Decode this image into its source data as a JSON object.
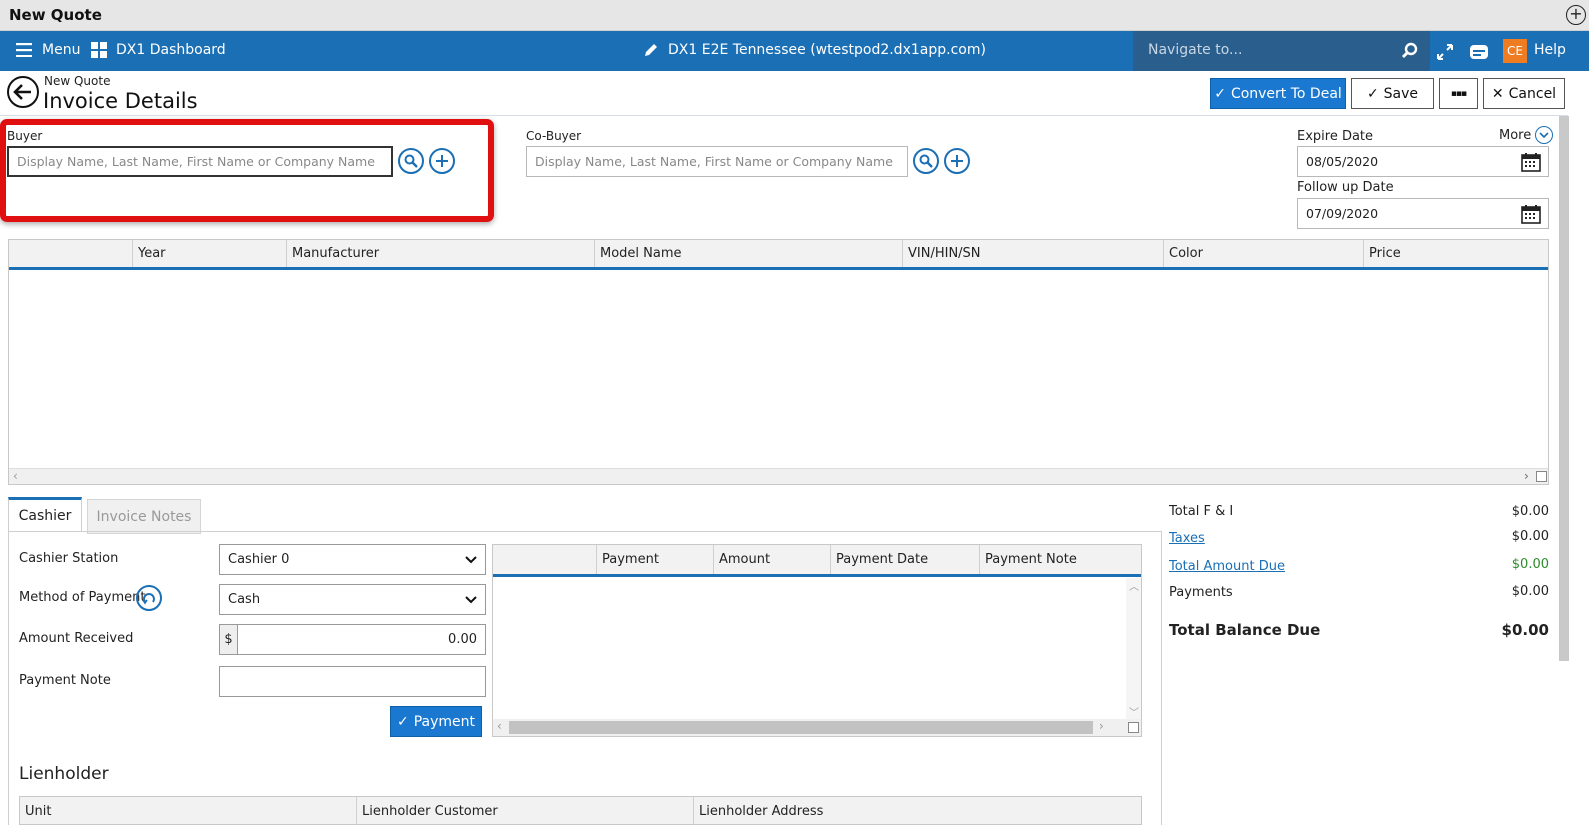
{
  "window": {
    "title": "New Quote"
  },
  "nav": {
    "menu_label": "Menu",
    "dashboard_label": "DX1 Dashboard",
    "site_label": "DX1 E2E Tennessee (wtestpod2.dx1app.com)",
    "search_placeholder": "Navigate to...",
    "avatar_initials": "CE",
    "help_label": "Help"
  },
  "header": {
    "breadcrumb": "New Quote",
    "title": "Invoice Details",
    "convert_label": "Convert To Deal",
    "save_label": "Save",
    "more_dots": "▪▪▪",
    "cancel_label": "Cancel"
  },
  "buyer": {
    "label": "Buyer",
    "placeholder": "Display Name, Last Name, First Name or Company Name"
  },
  "cobuyer": {
    "label": "Co-Buyer",
    "placeholder": "Display Name, Last Name, First Name or Company Name"
  },
  "dates": {
    "more_label": "More",
    "expire_label": "Expire Date",
    "expire_value": "08/05/2020",
    "followup_label": "Follow up Date",
    "followup_value": "07/09/2020"
  },
  "units_grid": {
    "columns": [
      "Year",
      "Manufacturer",
      "Model Name",
      "VIN/HIN/SN",
      "Color",
      "Price"
    ]
  },
  "tabs": [
    {
      "label": "Cashier",
      "active": true
    },
    {
      "label": "Invoice Notes",
      "active": false
    }
  ],
  "cashier": {
    "station_label": "Cashier Station",
    "station_value": "Cashier 0",
    "method_label": "Method of Payment",
    "method_value": "Cash",
    "amount_label": "Amount Received",
    "currency": "$",
    "amount_value": "0.00",
    "note_label": "Payment Note",
    "note_value": "",
    "payment_button": "Payment"
  },
  "payments_grid": {
    "columns": [
      "Payment",
      "Amount",
      "Payment Date",
      "Payment Note"
    ]
  },
  "totals": {
    "fi_label": "Total F & I",
    "fi_value": "$0.00",
    "taxes_label": "Taxes",
    "taxes_value": "$0.00",
    "amount_due_label": "Total Amount Due",
    "amount_due_value": "$0.00",
    "payments_label": "Payments",
    "payments_value": "$0.00",
    "balance_label": "Total Balance Due",
    "balance_value": "$0.00"
  },
  "lienholder": {
    "title": "Lienholder",
    "columns": [
      "Unit",
      "Lienholder Customer",
      "Lienholder Address"
    ]
  },
  "colors": {
    "brand_blue": "#1b6fb5",
    "highlight_red": "#e01010",
    "amount_due_green": "#2e8b2e"
  }
}
